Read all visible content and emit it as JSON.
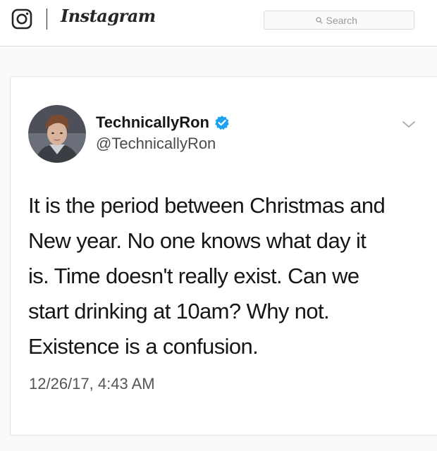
{
  "header": {
    "wordmark": "Instagram",
    "logo_icon": "instagram-camera-icon",
    "search": {
      "placeholder": "Search",
      "icon": "search-icon"
    }
  },
  "post": {
    "tweet": {
      "display_name": "TechnicallyRon",
      "handle": "@TechnicallyRon",
      "verified": true,
      "verified_color": "#1da1f2",
      "text": "It is the period between Christmas and\nNew year. No one knows what day it\nis. Time doesn't really exist. Can we\nstart drinking at 10am? Why not.\nExistence is a confusion.",
      "timestamp": "12/26/17, 4:43 AM",
      "menu_icon": "chevron-down-icon"
    }
  }
}
